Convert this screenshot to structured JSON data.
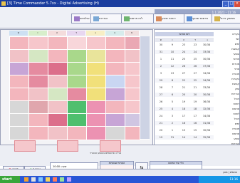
{
  "window": {
    "title": "[3] Time Commander 5.7xx - Digital Advertising (H)",
    "right_info": "1.1.2021 - 11:16"
  },
  "toolbar": {
    "buttons": [
      {
        "label": "אולפנים",
        "icon": "gear-icon"
      },
      {
        "label": "הגדרות",
        "icon": "settings-icon"
      },
      {
        "label": "לוח פרסום",
        "icon": "grid-icon"
      },
      {
        "label": "דוחות שיווק",
        "icon": "report-icon"
      },
      {
        "label": "פרסום שבועי",
        "icon": "calendar-icon"
      },
      {
        "label": "ממשק ניהול",
        "icon": "folder-icon"
      }
    ]
  },
  "grid": {
    "days": [
      "ש",
      "ו",
      "ה",
      "ד",
      "ג",
      "ב",
      "א"
    ]
  },
  "calendar": {
    "title": "לוח חודשי",
    "headers": [
      "ש",
      "ו",
      "ה",
      "ד",
      "ג"
    ],
    "rows": [
      [
        "30",
        "9",
        "23",
        "23",
        "30/38"
      ],
      [
        "31",
        "10",
        "24",
        "24",
        "33/38"
      ],
      [
        "1",
        "11",
        "25",
        "25",
        "30/38"
      ],
      [
        "2",
        "12",
        "26",
        "26",
        "37/38"
      ],
      [
        "3",
        "13",
        "27",
        "27",
        "34/38"
      ],
      [
        "29",
        "8",
        "22",
        "22",
        "34/38"
      ],
      [
        "28",
        "7",
        "21",
        "21",
        "33/38"
      ],
      [
        "27",
        "6",
        "20",
        "20",
        "30/38"
      ],
      [
        "26",
        "5",
        "19",
        "19",
        "36/38"
      ],
      [
        "25",
        "4",
        "18",
        "18",
        "32/38"
      ],
      [
        "24",
        "3",
        "17",
        "17",
        "34/38"
      ],
      [
        "21",
        "2",
        "16",
        "16",
        "31/38"
      ],
      [
        "20",
        "1",
        "15",
        "15",
        "30/38"
      ],
      [
        "19",
        "31",
        "14",
        "14",
        "32/38"
      ]
    ],
    "footer": "1.1.2021 נתון"
  },
  "sidebar_labels": [
    "בקרים",
    "יומי",
    "ימים",
    "קבוצות",
    "שבועי",
    "חודשי",
    "מטרות",
    "פרטי",
    "תוכנית",
    "בקורות",
    "קבוצת",
    "שוק",
    "הגדרות",
    "ניהול",
    "דוחות",
    "פרסום",
    "לוחות",
    "ניהול",
    "ימים",
    "תוכנית",
    "פרסום",
    "שבוע",
    "הגדרות"
  ],
  "bottom": {
    "label_time": "סה\"כ פרסומים בשבוע הנוכחי",
    "field1_label": "שעה:",
    "field1_value": "10:00",
    "field2_label": "מספר:",
    "field2_value": "1",
    "notes_title": "הערות שבועיות",
    "panel_title": "כלי עזר וסיכום",
    "ok_label": "אישור",
    "close_label": "סגור"
  },
  "status": {
    "text": "הושלם | מוכן"
  },
  "taskbar": {
    "start": "start",
    "time": "11:16"
  }
}
